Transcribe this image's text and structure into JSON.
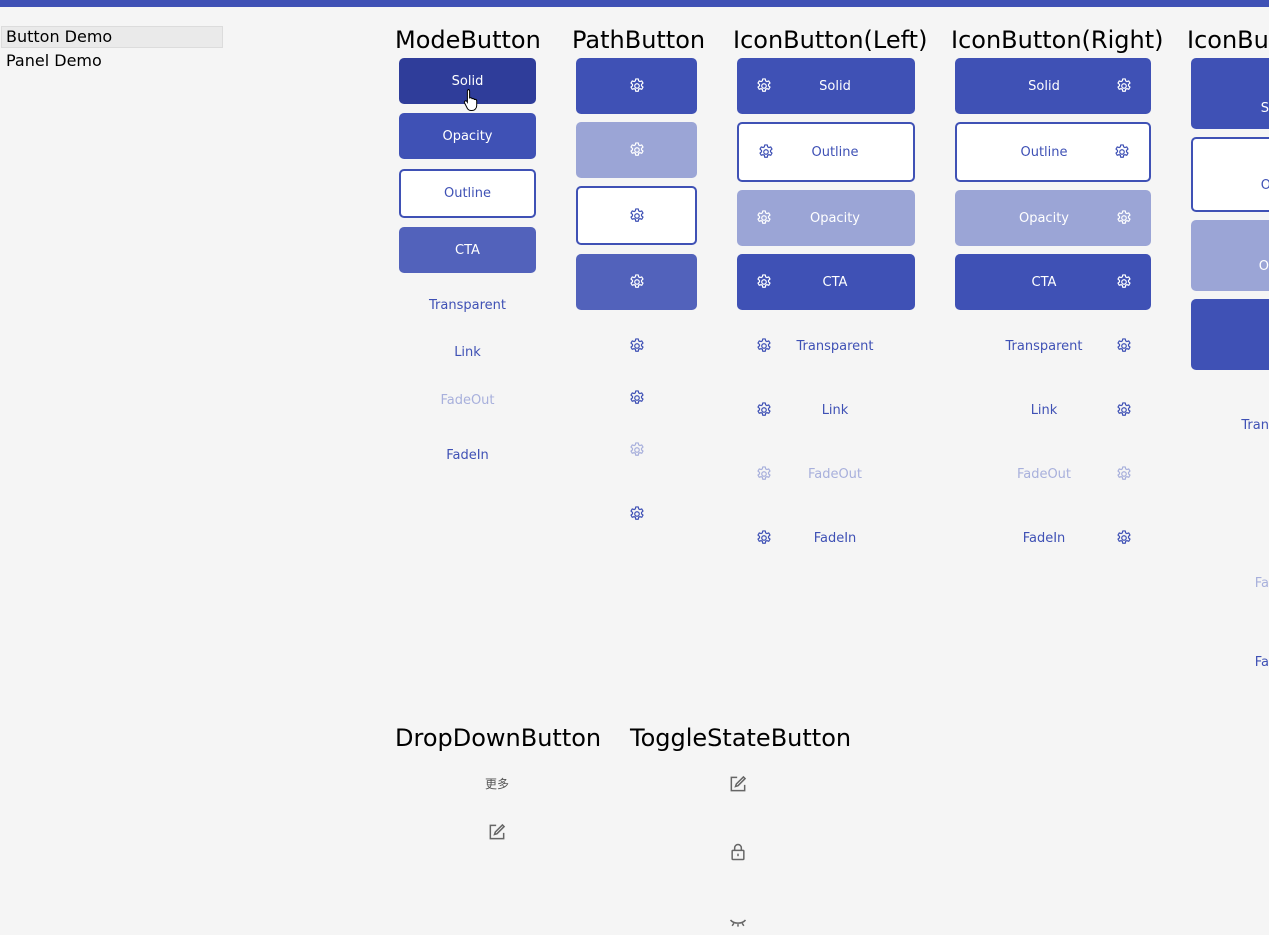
{
  "nav": {
    "items": [
      "Button Demo",
      "Panel Demo"
    ]
  },
  "mode_button": {
    "title": "ModeButton",
    "buttons": [
      "Solid",
      "Opacity",
      "Outline",
      "CTA",
      "Transparent",
      "Link",
      "FadeOut",
      "FadeIn"
    ]
  },
  "path_button": {
    "title": "PathButton",
    "icon": "gear-icon"
  },
  "icon_left": {
    "title": "IconButton(Left)",
    "buttons": [
      "Solid",
      "Outline",
      "Opacity",
      "CTA",
      "Transparent",
      "Link",
      "FadeOut",
      "FadeIn"
    ]
  },
  "icon_right": {
    "title": "IconButton(Right)",
    "buttons": [
      "Solid",
      "Outline",
      "Opacity",
      "CTA",
      "Transparent",
      "Link",
      "FadeOut",
      "FadeIn"
    ]
  },
  "icon_bu": {
    "title": "IconBu",
    "fragments": [
      "S",
      "O",
      "O",
      "Tran",
      "Fa",
      "Fa"
    ]
  },
  "dropdown_button": {
    "title": "DropDownButton",
    "more_label": "更多",
    "icon": "edit-icon"
  },
  "toggle_button": {
    "title": "ToggleStateButton",
    "icons": [
      "edit-icon",
      "lock-icon",
      "eye-closed-icon"
    ]
  },
  "colors": {
    "accent": "#3f51b5",
    "accent_light": "#9ba5d6",
    "accent_faded": "#a8b0dc",
    "background": "#f5f5f5"
  }
}
